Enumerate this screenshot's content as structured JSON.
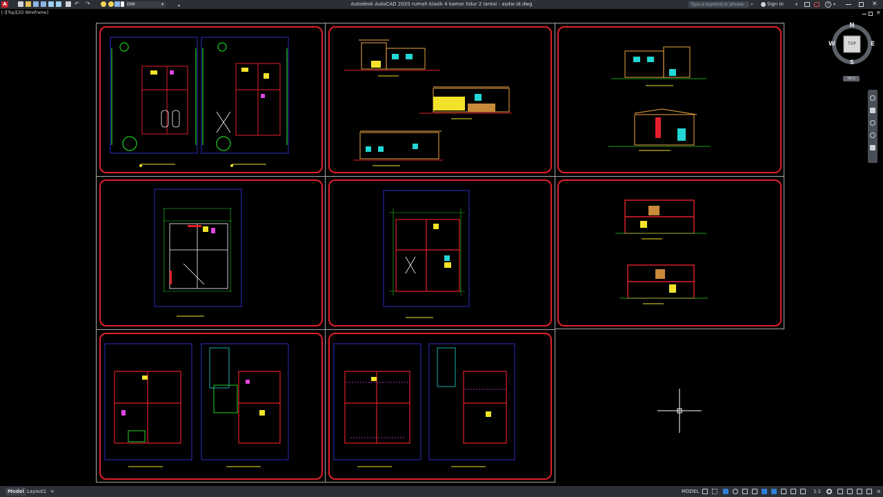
{
  "titlebar": {
    "app_title": "Autodesk AutoCAD 2020   rumah klasik 4 kamar tidur 2 lantai - asdar.id.dwg",
    "layer": "DIM",
    "search_placeholder": "Type a keyword or phrase",
    "signin": "Sign In"
  },
  "viewport": {
    "label": "[-][Top][2D Wireframe]"
  },
  "viewcube": {
    "top": "TOP",
    "north": "N",
    "south": "S",
    "east": "E",
    "west": "W",
    "wcs": "WCS"
  },
  "statusbar": {
    "tab_model": "Model",
    "tab_layout": "Layout1",
    "model_label": "MODEL",
    "scale": "1:1"
  },
  "colors": {
    "sheet_border": "#e5202a",
    "frame": "#a9a9a9",
    "background": "#000000",
    "chrome": "#2b2f36"
  }
}
